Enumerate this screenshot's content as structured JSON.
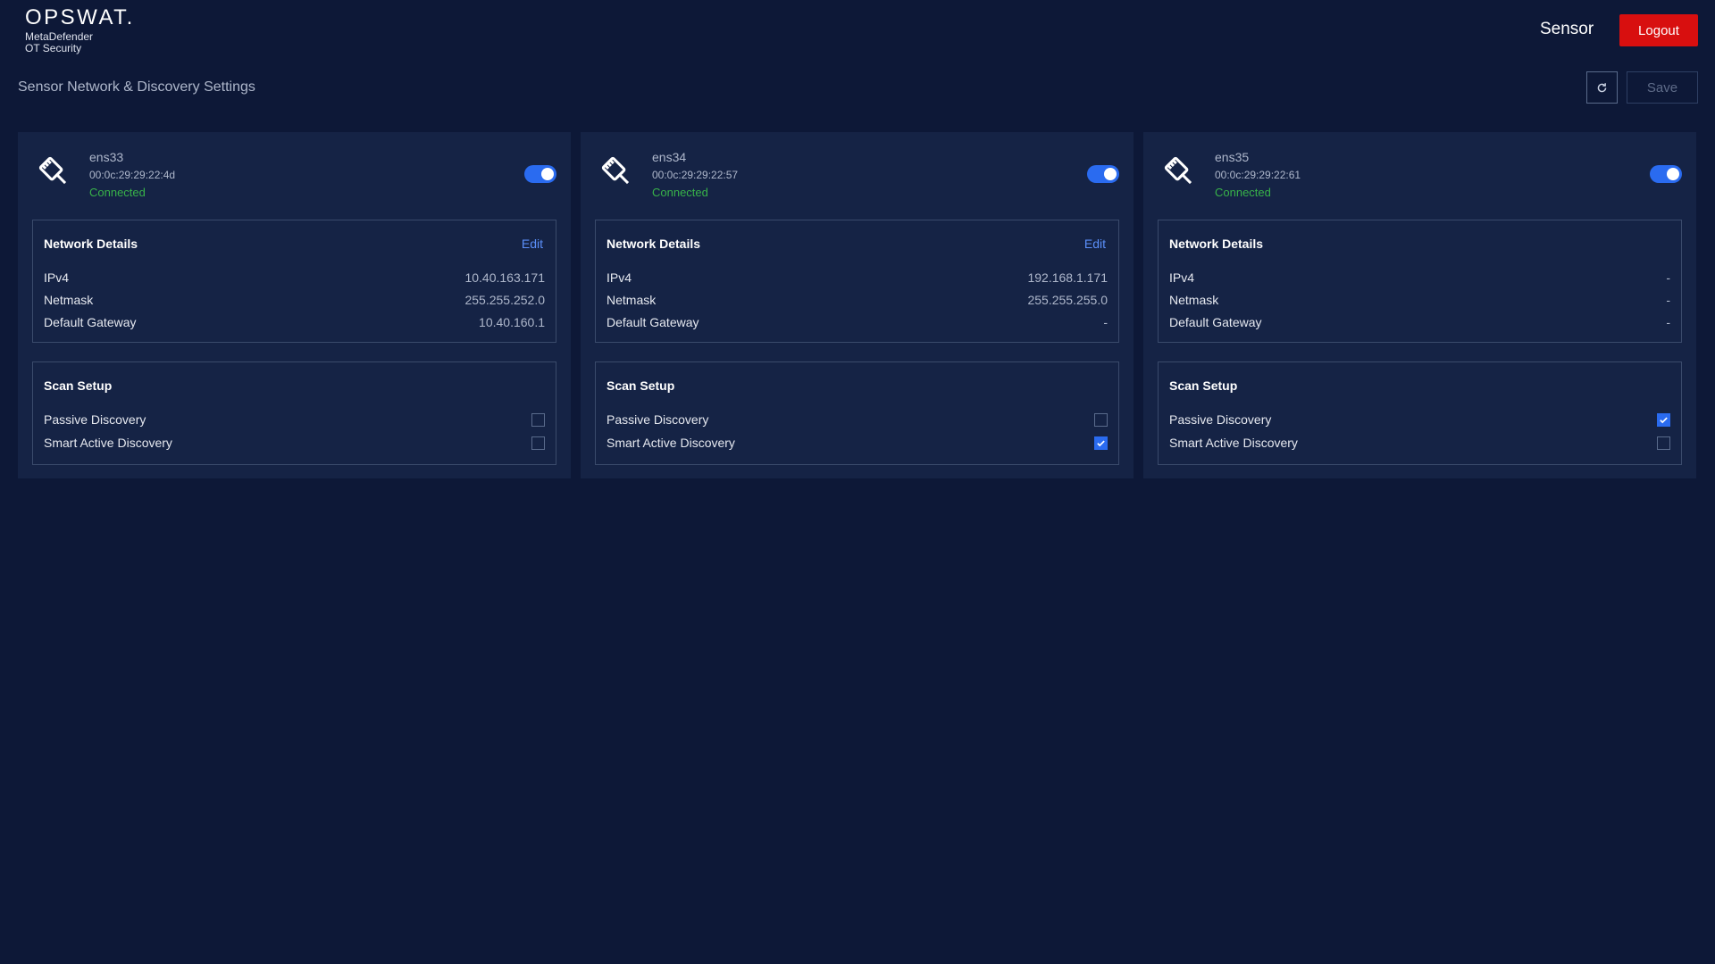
{
  "header": {
    "logo_word": "OPSWAT.",
    "logo_line1": "MetaDefender",
    "logo_line2": "OT Security",
    "sensor_label": "Sensor",
    "logout_label": "Logout"
  },
  "page": {
    "title": "Sensor Network & Discovery Settings",
    "save_label": "Save"
  },
  "labels": {
    "network_details": "Network Details",
    "edit": "Edit",
    "ipv4": "IPv4",
    "netmask": "Netmask",
    "gateway": "Default Gateway",
    "scan_setup": "Scan Setup",
    "passive": "Passive Discovery",
    "smart_active": "Smart Active Discovery"
  },
  "colors": {
    "background": "#0d1837",
    "card": "#152345",
    "accent": "#2a6bf0",
    "connected": "#38b249",
    "logout": "#d80f0f"
  },
  "interfaces": [
    {
      "name": "ens33",
      "mac": "00:0c:29:29:22:4d",
      "status": "Connected",
      "enabled": true,
      "editable": true,
      "ipv4": "10.40.163.171",
      "netmask": "255.255.252.0",
      "gateway": "10.40.160.1",
      "passive": false,
      "smart_active": false
    },
    {
      "name": "ens34",
      "mac": "00:0c:29:29:22:57",
      "status": "Connected",
      "enabled": true,
      "editable": true,
      "ipv4": "192.168.1.171",
      "netmask": "255.255.255.0",
      "gateway": "-",
      "passive": false,
      "smart_active": true
    },
    {
      "name": "ens35",
      "mac": "00:0c:29:29:22:61",
      "status": "Connected",
      "enabled": true,
      "editable": false,
      "ipv4": "-",
      "netmask": "-",
      "gateway": "-",
      "passive": true,
      "smart_active": false
    }
  ]
}
